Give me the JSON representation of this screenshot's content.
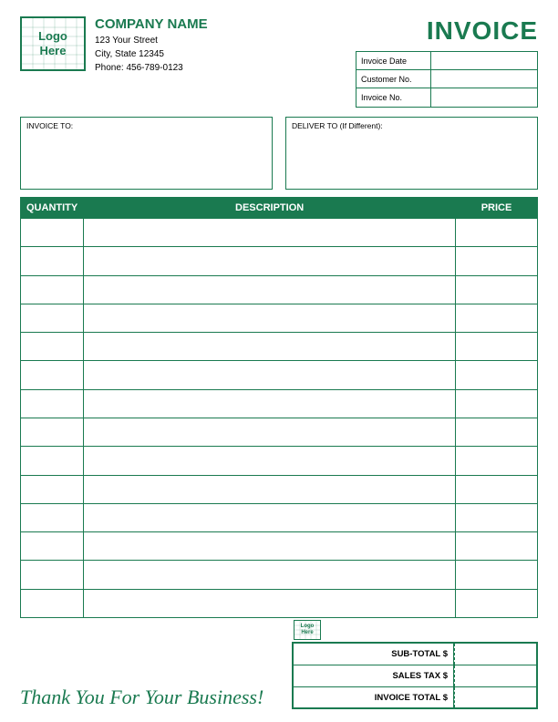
{
  "header": {
    "logo_line1": "Logo",
    "logo_line2": "Here",
    "company_name": "COMPANY NAME",
    "address_line1": "123 Your Street",
    "address_line2": "City, State 12345",
    "phone": "Phone: 456-789-0123",
    "invoice_title": "INVOICE",
    "fields": [
      {
        "label": "Invoice Date",
        "value": ""
      },
      {
        "label": "Customer No.",
        "value": ""
      },
      {
        "label": "Invoice No.",
        "value": ""
      }
    ]
  },
  "address": {
    "invoice_to_label": "INVOICE TO:",
    "deliver_to_label": "DELIVER TO (If Different):"
  },
  "table": {
    "col_quantity": "QUANTITY",
    "col_description": "DESCRIPTION",
    "col_price": "PRICE",
    "rows": 14
  },
  "totals": {
    "sub_total_label": "SUB-TOTAL $",
    "sales_tax_label": "SALES TAX $",
    "invoice_total_label": "INVOICE TOTAL $"
  },
  "footer": {
    "thank_you": "Thank You For Your Business!"
  }
}
